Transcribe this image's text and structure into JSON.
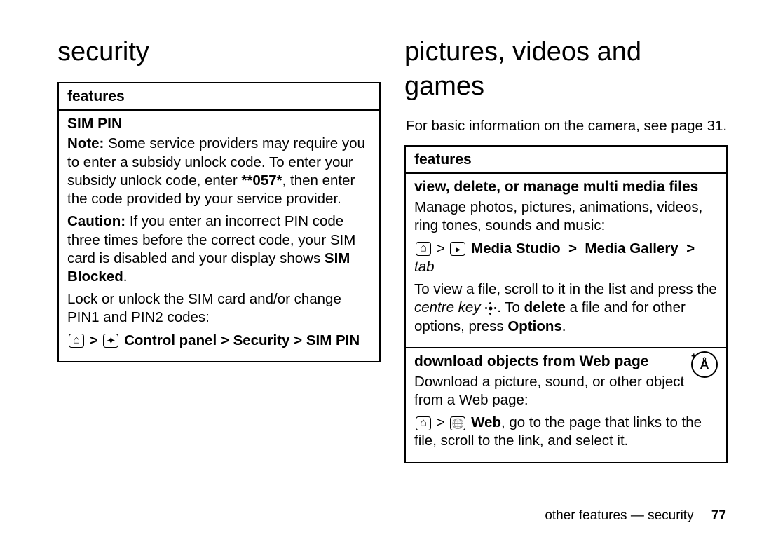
{
  "left": {
    "heading": "security",
    "features_label": "features",
    "sim_pin": {
      "title": "SIM PIN",
      "note_label": "Note:",
      "note_text_a": " Some service providers may require you to enter a subsidy unlock code. To enter your subsidy unlock code, enter ",
      "note_code": "**057*",
      "note_text_b": ", then enter the code provided by your service provider.",
      "caution_label": "Caution:",
      "caution_text_a": " If you enter an incorrect PIN code three times before the correct code, your SIM card is disabled and your display shows ",
      "caution_code": "SIM Blocked",
      "caution_text_b": ".",
      "lock_text": "Lock or unlock the SIM card and/or change PIN1 and PIN2 codes:",
      "path_a": "Control panel",
      "path_b": "Security",
      "path_c": "SIM PIN"
    }
  },
  "right": {
    "heading": "pictures, videos and games",
    "intro": "For basic information on the camera, see page 31.",
    "features_label": "features",
    "view": {
      "title": "view, delete, or manage multi media files",
      "body1": "Manage photos, pictures, animations, videos, ring tones, sounds and music:",
      "path_a": "Media Studio",
      "path_b": "Media Gallery",
      "path_tab": "tab",
      "body2_a": "To view a file, scroll to it in the list and press the ",
      "body2_centre": "centre key",
      "body2_b": ". To ",
      "body2_delete": "delete",
      "body2_c": " a file and for other options, press ",
      "body2_options": "Options",
      "body2_d": "."
    },
    "download": {
      "title": "download objects from Web page",
      "body1": "Download a picture, sound, or other object from a Web page:",
      "path_a": "Web",
      "body2": ", go to the page that links to the file, scroll to the link, and select it."
    }
  },
  "footer": {
    "text": "other features — security",
    "page": "77"
  }
}
